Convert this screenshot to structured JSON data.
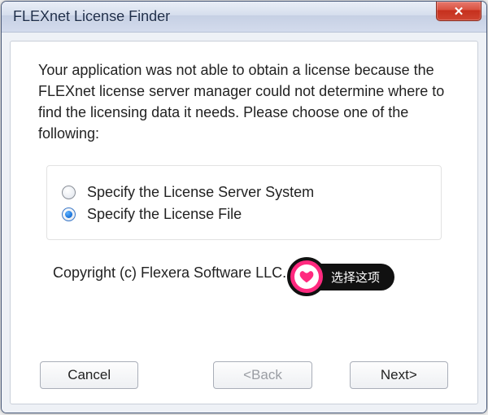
{
  "window": {
    "title": "FLEXnet License Finder"
  },
  "message": "Your application was not able to obtain a license because the FLEXnet license server manager could not determine where to find the licensing data it needs.  Please choose one of the following:",
  "options": {
    "server": "Specify the License Server System",
    "file": "Specify the License File",
    "selected": "file"
  },
  "callout": {
    "label": "选择这项"
  },
  "copyright": "Copyright (c) Flexera Software LLC.",
  "buttons": {
    "cancel": "Cancel",
    "back": "<Back",
    "next": "Next>"
  }
}
